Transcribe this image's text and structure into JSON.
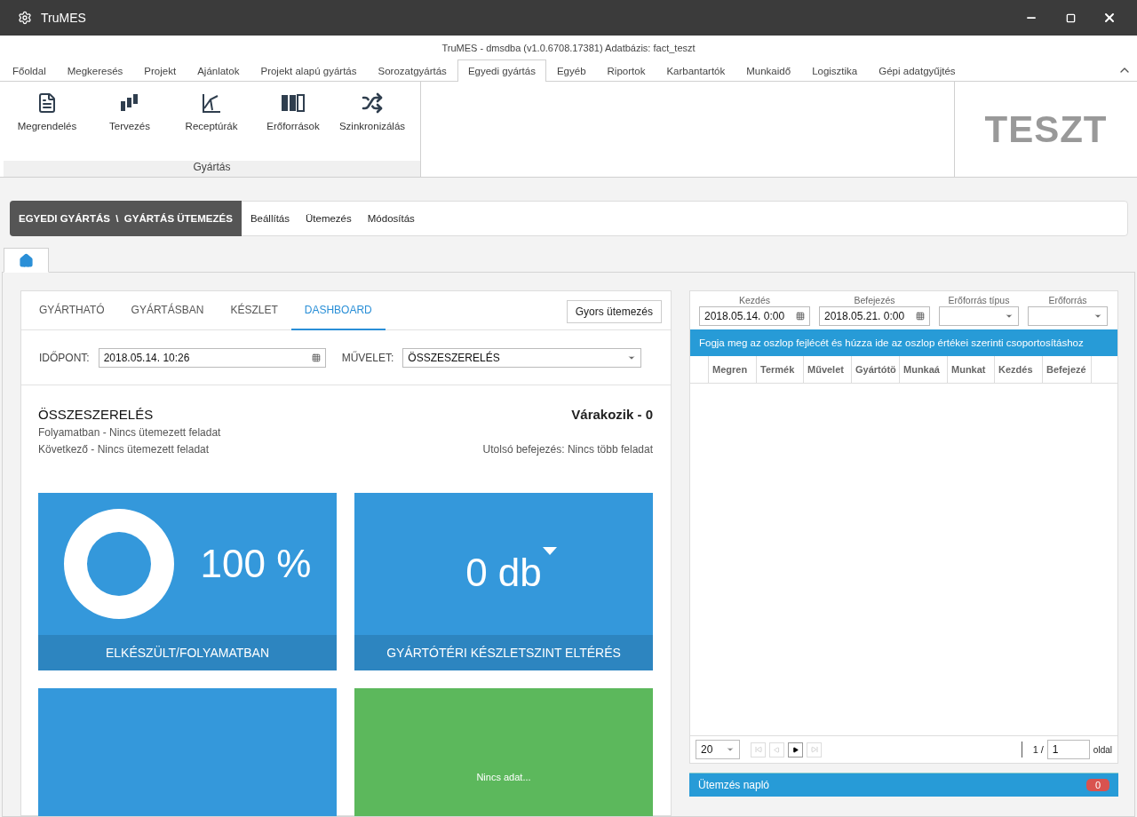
{
  "window": {
    "title": "TruMES"
  },
  "subtitle": "TruMES - dmsdba (v1.0.6708.17381) Adatbázis: fact_teszt",
  "ribbon_tabs": [
    {
      "label": "Főoldal",
      "selected": false
    },
    {
      "label": "Megkeresés",
      "selected": false
    },
    {
      "label": "Projekt",
      "selected": false
    },
    {
      "label": "Ajánlatok",
      "selected": false
    },
    {
      "label": "Projekt alapú gyártás",
      "selected": false
    },
    {
      "label": "Sorozatgyártás",
      "selected": false
    },
    {
      "label": "Egyedi gyártás",
      "selected": true
    },
    {
      "label": "Egyéb",
      "selected": false
    },
    {
      "label": "Riportok",
      "selected": false
    },
    {
      "label": "Karbantartók",
      "selected": false
    },
    {
      "label": "Munkaidő",
      "selected": false
    },
    {
      "label": "Logisztika",
      "selected": false
    },
    {
      "label": "Gépi adatgyűjtés",
      "selected": false
    }
  ],
  "ribbon_group": {
    "label": "Gyártás",
    "buttons": [
      {
        "label": "Megrendelés"
      },
      {
        "label": "Tervezés"
      },
      {
        "label": "Receptúrák"
      },
      {
        "label": "Erőforrások"
      },
      {
        "label": "Szinkronizálás"
      }
    ]
  },
  "logo": "TESZT",
  "breadcrumb": {
    "path": "EGYEDI GYÁRTÁS  \\  GYÁRTÁS ÜTEMEZÉS",
    "links": [
      "Beállítás",
      "Ütemezés",
      "Módosítás"
    ]
  },
  "left": {
    "tabs": [
      {
        "label": "GYÁRTHATÓ",
        "selected": false
      },
      {
        "label": "GYÁRTÁSBAN",
        "selected": false
      },
      {
        "label": "KÉSZLET",
        "selected": false
      },
      {
        "label": "DASHBOARD",
        "selected": true
      }
    ],
    "quick_button": "Gyors ütemezés",
    "time_label": "IDŐPONT:",
    "time_value": "2018.05.14. 10:26",
    "op_label": "MŰVELET:",
    "op_value": "ÖSSZESZERELÉS",
    "summary": {
      "title": "ÖSSZESZERELÉS",
      "waiting": "Várakozik - 0",
      "in_progress": "Folyamatban - Nincs ütemezett feladat",
      "next": "Következő - Nincs ütemezett feladat",
      "last": "Utolsó befejezés: Nincs több feladat"
    },
    "tiles": [
      {
        "kind": "donut",
        "level": 1,
        "value": "100 %",
        "caption": "ELKÉSZÜLT/FOLYAMATBAN",
        "color": "#3498db"
      },
      {
        "kind": "value",
        "value": "0 db",
        "caption": "GYÁRTÓTÉRI KÉSZLETSZINT ELTÉRÉS",
        "color": "#3498db"
      },
      {
        "kind": "empty",
        "color": "#3498db"
      },
      {
        "kind": "message",
        "value": "Nincs adat...",
        "color": "#5cb85c"
      }
    ]
  },
  "right": {
    "filters": [
      {
        "kind": "date",
        "label": "Kezdés",
        "value": "2018.05.14. 0:00"
      },
      {
        "kind": "date",
        "label": "Befejezés",
        "value": "2018.05.21. 0:00"
      },
      {
        "kind": "select",
        "label": "Erőforrás típus"
      },
      {
        "kind": "select",
        "label": "Erőforrás"
      }
    ],
    "group_hint": "Fogja meg az oszlop fejlécét és húzza ide az oszlop értékei szerinti csoportosításhoz",
    "columns": [
      "Megren",
      "Termék",
      "Művelet",
      "Gyártótö",
      "Munkaá",
      "Munkat",
      "Kezdés",
      "Befejezé"
    ],
    "pager": {
      "page_size": "20",
      "page_of": "1 /",
      "page": "1",
      "suffix": "oldal"
    },
    "log": {
      "title": "Ütemzés napló",
      "count": "0"
    }
  }
}
